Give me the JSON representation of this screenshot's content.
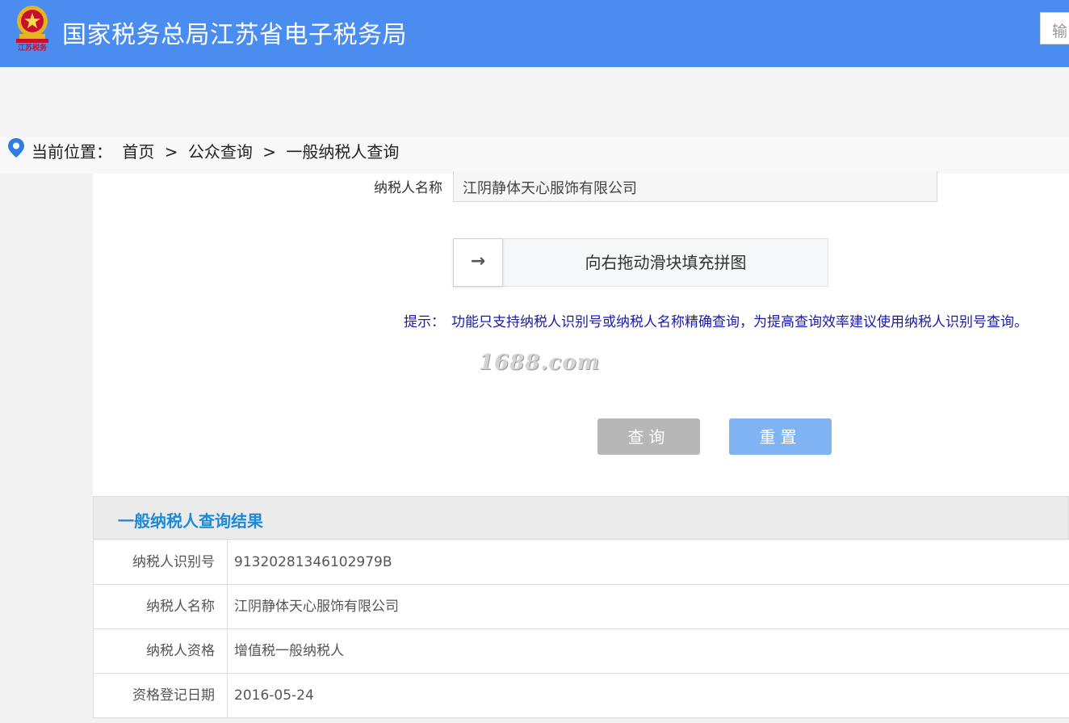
{
  "header": {
    "title": "国家税务总局江苏省电子税务局",
    "logo_text": "江苏税务",
    "search_placeholder": "输",
    "bg_color": "#4a8cf0"
  },
  "breadcrumb": {
    "label": "当前位置：",
    "items": [
      "首页",
      ">",
      "公众查询",
      ">",
      "一般纳税人查询"
    ]
  },
  "form": {
    "name_label": "纳税人名称",
    "name_value": "江阴静体天心服饰有限公司",
    "slider_icon": "→",
    "slider_text": "向右拖动滑块填充拼图",
    "tip_label": "提示：",
    "tip_text": "功能只支持纳税人识别号或纳税人名称精确查询，为提高查询效率建议使用纳税人识别号查询。",
    "watermark": "1688.com",
    "query_label": "查询",
    "reset_label": "重置"
  },
  "result": {
    "title": "一般纳税人查询结果",
    "rows": [
      {
        "key": "纳税人识别号",
        "value": "91320281346102979B"
      },
      {
        "key": "纳税人名称",
        "value": "江阴静体天心服饰有限公司"
      },
      {
        "key": "纳税人资格",
        "value": "增值税一般纳税人"
      },
      {
        "key": "资格登记日期",
        "value": "2016-05-24"
      }
    ]
  },
  "colors": {
    "accent": "#4a8cf0",
    "result_title": "#1d8ad9",
    "tip": "#1a1aa8",
    "query_button": "#b7b7b7",
    "reset_button": "#7fb3f2"
  }
}
